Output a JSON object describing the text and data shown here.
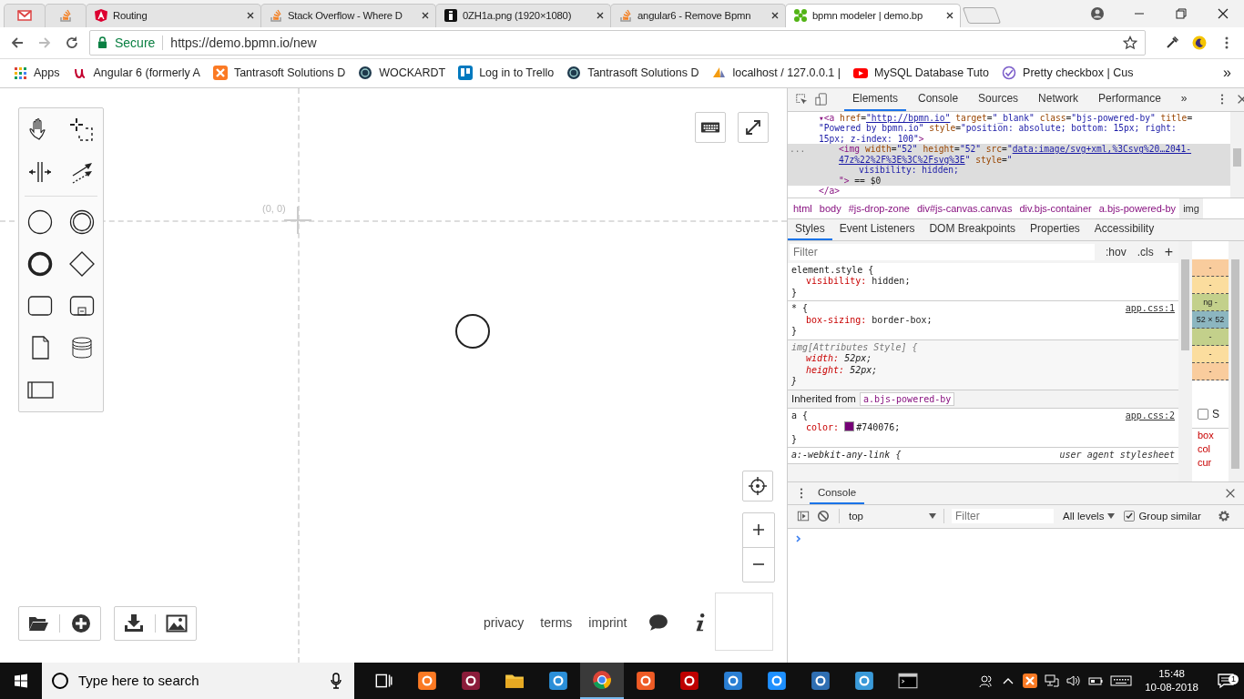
{
  "browser_tabs": [
    {
      "kind": "gmail",
      "selected": false
    },
    {
      "kind": "stack",
      "selected": false
    },
    {
      "kind": "angular",
      "title": "Routing",
      "selected": false
    },
    {
      "kind": "stack",
      "title": "Stack Overflow - Where D",
      "selected": false
    },
    {
      "kind": "image",
      "title": "0ZH1a.png (1920×1080)",
      "selected": false
    },
    {
      "kind": "stack",
      "title": "angular6 - Remove Bpmn",
      "selected": false
    },
    {
      "kind": "bpmn",
      "title": "bpmn modeler | demo.bp",
      "selected": true
    }
  ],
  "address_bar": {
    "secure_label": "Secure",
    "url": "https://demo.bpmn.io/new"
  },
  "bookmarks": [
    {
      "kind": "apps",
      "label": "Apps"
    },
    {
      "kind": "angular-u",
      "label": "Angular 6 (formerly A"
    },
    {
      "kind": "xampp",
      "label": "Tantrasoft Solutions D"
    },
    {
      "kind": "globe",
      "label": "WOCKARDT"
    },
    {
      "kind": "trello",
      "label": "Log in to Trello"
    },
    {
      "kind": "globe",
      "label": "Tantrasoft Solutions D"
    },
    {
      "kind": "pma",
      "label": "localhost / 127.0.0.1 |"
    },
    {
      "kind": "youtube",
      "label": "MySQL Database Tuto"
    },
    {
      "kind": "check",
      "label": "Pretty checkbox | Cus"
    }
  ],
  "bookmarks_more": "»",
  "palette": {
    "groups": [
      {
        "tools": [
          {
            "kind": "hand"
          },
          {
            "kind": "lasso"
          },
          {
            "kind": "space"
          },
          {
            "kind": "connect"
          }
        ]
      },
      {
        "tools": [
          {
            "kind": "start-event"
          },
          {
            "kind": "intermediate-event"
          },
          {
            "kind": "end-event"
          },
          {
            "kind": "gateway"
          },
          {
            "kind": "task"
          },
          {
            "kind": "subprocess"
          },
          {
            "kind": "data-object"
          },
          {
            "kind": "data-store"
          },
          {
            "kind": "participant"
          }
        ]
      }
    ]
  },
  "canvas": {
    "origin_label": "(0, 0)",
    "elements": [
      {
        "kind": "start-event"
      }
    ]
  },
  "file_buttons": [
    [
      {
        "kind": "open"
      },
      {
        "kind": "new"
      }
    ],
    [
      {
        "kind": "download"
      },
      {
        "kind": "image"
      }
    ]
  ],
  "footer_links": [
    "privacy",
    "terms",
    "imprint"
  ],
  "devtools": {
    "tabs": [
      {
        "label": "Elements",
        "selected": true
      },
      {
        "label": "Console",
        "selected": false
      },
      {
        "label": "Sources",
        "selected": false
      },
      {
        "label": "Network",
        "selected": false
      },
      {
        "label": "Performance",
        "selected": false
      }
    ],
    "more": "»",
    "dom_tree": [
      {
        "lines": [
          {
            "selected": false,
            "tokens": [
              {
                "kind": "tag",
                "t": "▾<a "
              },
              {
                "kind": "attr",
                "t": "href"
              },
              {
                "kind": "plain",
                "t": "="
              },
              {
                "kind": "link",
                "t": "\"http://bpmn.io\""
              },
              {
                "kind": "attr",
                "t": " target"
              },
              {
                "kind": "plain",
                "t": "="
              },
              {
                "kind": "val",
                "t": "\"_blank\""
              },
              {
                "kind": "attr",
                "t": " class"
              },
              {
                "kind": "plain",
                "t": "="
              },
              {
                "kind": "val",
                "t": "\"bjs-powered-by\""
              },
              {
                "kind": "attr",
                "t": " title"
              },
              {
                "kind": "plain",
                "t": "="
              }
            ]
          },
          {
            "selected": false,
            "tokens": [
              {
                "kind": "val",
                "t": "\"Powered by bpmn.io\""
              },
              {
                "kind": "attr",
                "t": " style"
              },
              {
                "kind": "plain",
                "t": "="
              },
              {
                "kind": "val",
                "t": "\"position: absolute; bottom: 15px; right:"
              }
            ]
          },
          {
            "selected": false,
            "tokens": [
              {
                "kind": "val",
                "t": "15px; z-index: 100\""
              },
              {
                "kind": "tag",
                "t": ">"
              }
            ]
          }
        ],
        "children": [
          {
            "lines": [
              {
                "selected": true,
                "gutter": "...",
                "tokens": [
                  {
                    "kind": "tag",
                    "t": "<img"
                  },
                  {
                    "kind": "attr",
                    "t": " width"
                  },
                  {
                    "kind": "plain",
                    "t": "="
                  },
                  {
                    "kind": "val",
                    "t": "\"52\""
                  },
                  {
                    "kind": "attr",
                    "t": " height"
                  },
                  {
                    "kind": "plain",
                    "t": "="
                  },
                  {
                    "kind": "val",
                    "t": "\"52\""
                  },
                  {
                    "kind": "attr",
                    "t": " src"
                  },
                  {
                    "kind": "plain",
                    "t": "="
                  },
                  {
                    "kind": "val",
                    "t": "\""
                  },
                  {
                    "kind": "link",
                    "t": "data:image/svg+xml,%3Csvg%20…2041-"
                  }
                ]
              },
              {
                "selected": true,
                "tokens": [
                  {
                    "kind": "link",
                    "t": "47z%22%2F%3E%3C%2Fsvg%3E"
                  },
                  {
                    "kind": "val",
                    "t": "\""
                  },
                  {
                    "kind": "attr",
                    "t": " style"
                  },
                  {
                    "kind": "plain",
                    "t": "="
                  },
                  {
                    "kind": "val",
                    "t": "\""
                  }
                ]
              }
            ],
            "children": [
              {
                "lines": [
                  {
                    "selected": true,
                    "tokens": [
                      {
                        "kind": "val",
                        "t": "visibility:  hidden;"
                      }
                    ]
                  }
                ]
              }
            ],
            "tail": [
              {
                "selected": true,
                "tokens": [
                  {
                    "kind": "tag",
                    "t": "\">"
                  },
                  {
                    "kind": "plain",
                    "t": " == $0"
                  }
                ]
              }
            ]
          }
        ],
        "tail": [
          {
            "selected": false,
            "tokens": [
              {
                "kind": "tag",
                "t": "</a>"
              }
            ]
          }
        ]
      }
    ],
    "breadcrumbs": [
      {
        "label": "html",
        "selected": false
      },
      {
        "label": "body",
        "selected": false
      },
      {
        "label": "#js-drop-zone",
        "selected": false
      },
      {
        "label": "div#js-canvas.canvas",
        "selected": false
      },
      {
        "label": "div.bjs-container",
        "selected": false
      },
      {
        "label": "a.bjs-powered-by",
        "selected": false
      },
      {
        "label": "img",
        "selected": true
      }
    ],
    "sidebar_tabs": [
      {
        "label": "Styles",
        "selected": true
      },
      {
        "label": "Event Listeners",
        "selected": false
      },
      {
        "label": "DOM Breakpoints",
        "selected": false
      },
      {
        "label": "Properties",
        "selected": false
      },
      {
        "label": "Accessibility",
        "selected": false
      }
    ],
    "styles_filter": {
      "placeholder": "Filter"
    },
    "hov": ":hov",
    "cls": ".cls",
    "add": "+",
    "rules": [
      {
        "kind": "rule",
        "selector": "element.style {",
        "declarations": [
          {
            "prop": "visibility:",
            "value": "hidden;"
          }
        ],
        "close": "}"
      },
      {
        "kind": "rule",
        "selector": "* {",
        "source": "app.css:1",
        "declarations": [
          {
            "prop": "box-sizing:",
            "value": "border-box;"
          }
        ],
        "close": "}"
      },
      {
        "kind": "attributes",
        "selector": "img[Attributes Style] {",
        "declarations": [
          {
            "prop": "width:",
            "value": "52px;"
          },
          {
            "prop": "height:",
            "value": "52px;"
          }
        ],
        "close": "}"
      },
      {
        "kind": "inherited",
        "label": "Inherited from",
        "ref": "a.bjs-powered-by"
      },
      {
        "kind": "rule",
        "selector": "a {",
        "source": "app.css:2",
        "declarations": [
          {
            "prop": "color:",
            "value": "#740076;",
            "swatch": true
          }
        ],
        "close": "}"
      },
      {
        "kind": "useragent",
        "selector": "a:-webkit-any-link {",
        "source": "user agent stylesheet"
      }
    ],
    "box_model": [
      {
        "text": "-",
        "color": "#f9cc9d"
      },
      {
        "text": "-",
        "color": "#fbdd9e"
      },
      {
        "text": "ng -",
        "color": "#c3d08b"
      },
      {
        "text": "52 × 52",
        "color": "#8cb6c0"
      },
      {
        "text": "-",
        "color": "#c3d08b"
      },
      {
        "text": "-",
        "color": "#fbdd9e"
      },
      {
        "text": "-",
        "color": "#f9cc9d"
      }
    ],
    "show_all": {
      "label": "S",
      "checked": false
    },
    "computed": [
      "box",
      "col",
      "cur"
    ]
  },
  "console": {
    "tab": {
      "label": "Console",
      "selected": true
    },
    "context": "top",
    "filter_placeholder": "Filter",
    "levels": "All levels",
    "group_similar": {
      "label": "Group similar",
      "checked": true
    }
  },
  "taskbar": {
    "search_placeholder": "Type here to search",
    "apps": [
      {
        "kind": "taskview",
        "active": false
      },
      {
        "kind": "xampp",
        "active": false
      },
      {
        "kind": "winrar",
        "active": false
      },
      {
        "kind": "folder",
        "active": false
      },
      {
        "kind": "vscode",
        "active": false
      },
      {
        "kind": "chrome",
        "active": true
      },
      {
        "kind": "postman",
        "active": false
      },
      {
        "kind": "filezilla",
        "active": false
      },
      {
        "kind": "dolphin",
        "active": false
      },
      {
        "kind": "sync",
        "active": false
      },
      {
        "kind": "thunderbird",
        "active": false
      },
      {
        "kind": "vs",
        "active": false
      },
      {
        "kind": "terminal",
        "active": false
      }
    ],
    "time": "15:48",
    "date": "10-08-2018",
    "notification_count": "1"
  }
}
